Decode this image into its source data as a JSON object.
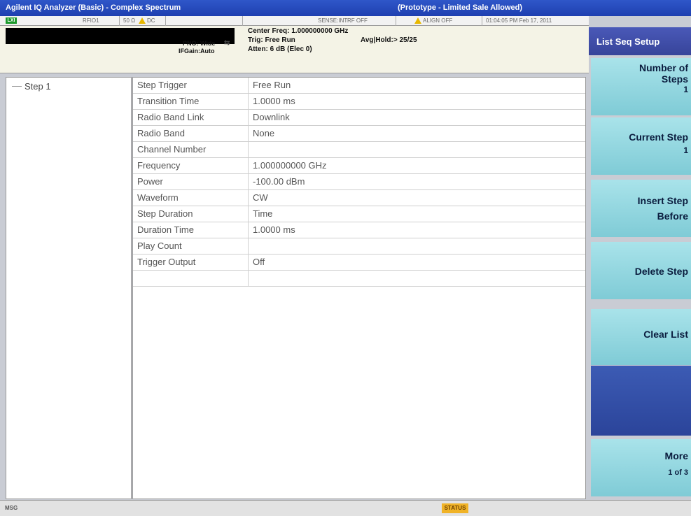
{
  "titlebar": {
    "app_title": "Agilent IQ Analyzer (Basic) - Complex Spectrum",
    "prototype": "(Prototype - Limited Sale Allowed)"
  },
  "status_row": {
    "lxi": "LXI",
    "rf_port": "RFIO1",
    "impedance": "50 Ω",
    "coupling": "DC",
    "sense": "SENSE:INT",
    "rf_state": "RF OFF",
    "align": "ALIGN OFF",
    "timestamp": "01:04:05 PM Feb 17, 2011"
  },
  "header": {
    "center_freq": "Center Freq: 1.000000000 GHz",
    "trig": "Trig: Free Run",
    "avg_hold": "Avg|Hold:> 25/25",
    "atten": "Atten: 6 dB (Elec 0)",
    "pno": "PNO: Wide",
    "ifgain": "IFGain:Auto"
  },
  "tree": {
    "step_label": "Step 1"
  },
  "table": {
    "rows": [
      {
        "key": "Step Trigger",
        "value": "Free Run"
      },
      {
        "key": "Transition Time",
        "value": "1.0000 ms"
      },
      {
        "key": "Radio Band Link",
        "value": "Downlink"
      },
      {
        "key": "Radio Band",
        "value": "None"
      },
      {
        "key": "Channel Number",
        "value": ""
      },
      {
        "key": "Frequency",
        "value": "1.000000000 GHz"
      },
      {
        "key": "Power",
        "value": "-100.00 dBm"
      },
      {
        "key": "Waveform",
        "value": "CW"
      },
      {
        "key": "Step Duration",
        "value": "Time"
      },
      {
        "key": "Duration Time",
        "value": "1.0000 ms"
      },
      {
        "key": "Play Count",
        "value": ""
      },
      {
        "key": "Trigger Output",
        "value": "Off"
      },
      {
        "key": "",
        "value": ""
      }
    ]
  },
  "softkeys": {
    "menu_title": "List Seq Setup",
    "number_of_steps": {
      "line1": "Number of",
      "line2": "Steps",
      "value": "1"
    },
    "current_step": {
      "label": "Current Step",
      "value": "1"
    },
    "insert_step": {
      "line1": "Insert Step",
      "line2": "Before"
    },
    "delete_step": {
      "label": "Delete Step"
    },
    "clear_list": {
      "label": "Clear List"
    },
    "more": {
      "label": "More",
      "page": "1 of 3"
    }
  },
  "bottom": {
    "msg": "MSG",
    "status": "STATUS"
  },
  "colors": {
    "titlebar": "#2f57c9",
    "softkey": "#a9e3ea",
    "softkey_menu_title": "#4a59b8",
    "status_button": "#f0b327"
  }
}
